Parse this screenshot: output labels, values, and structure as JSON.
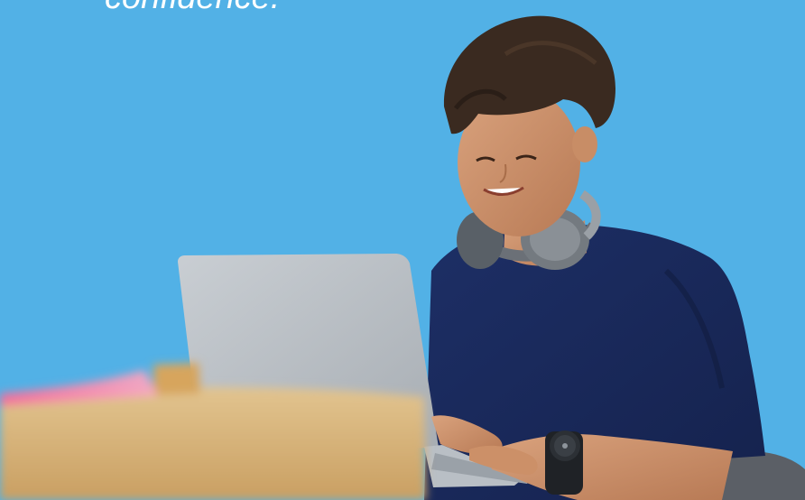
{
  "hero": {
    "headline": "confidence.",
    "background_color": "#52b1e6"
  },
  "photo": {
    "subject": "student-using-laptop",
    "accessories": [
      "headphones-icon",
      "wristwatch-icon"
    ]
  }
}
